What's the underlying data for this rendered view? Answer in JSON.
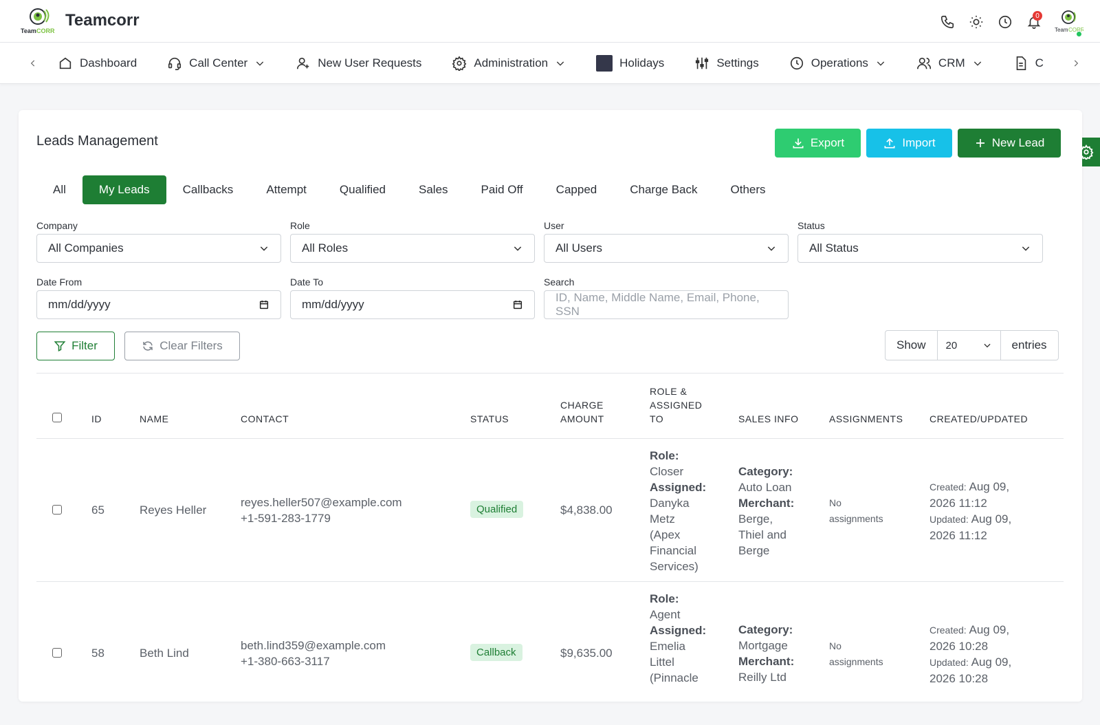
{
  "app": {
    "brand": "Teamcorr",
    "logo_text": "TeamCORR",
    "notifications_count": "0"
  },
  "nav": {
    "items": [
      {
        "label": "Dashboard",
        "icon": "home-icon",
        "dropdown": false
      },
      {
        "label": "Call Center",
        "icon": "headset-icon",
        "dropdown": true
      },
      {
        "label": "New User Requests",
        "icon": "user-plus-icon",
        "dropdown": false
      },
      {
        "label": "Administration",
        "icon": "gear-icon",
        "dropdown": true
      },
      {
        "label": "Holidays",
        "icon": "holiday-square-icon",
        "dropdown": false
      },
      {
        "label": "Settings",
        "icon": "sliders-icon",
        "dropdown": false
      },
      {
        "label": "Operations",
        "icon": "clock-icon",
        "dropdown": true
      },
      {
        "label": "CRM",
        "icon": "users-icon",
        "dropdown": true
      },
      {
        "label": "C",
        "icon": "document-icon",
        "dropdown": false
      }
    ]
  },
  "page": {
    "title": "Leads Management",
    "export_label": "Export",
    "import_label": "Import",
    "new_lead_label": "New Lead"
  },
  "tabs": [
    "All",
    "My Leads",
    "Callbacks",
    "Attempt",
    "Qualified",
    "Sales",
    "Paid Off",
    "Capped",
    "Charge Back",
    "Others"
  ],
  "active_tab": "My Leads",
  "filters": {
    "company": {
      "label": "Company",
      "value": "All Companies"
    },
    "role": {
      "label": "Role",
      "value": "All Roles"
    },
    "user": {
      "label": "User",
      "value": "All Users"
    },
    "status": {
      "label": "Status",
      "value": "All Status"
    },
    "date_from": {
      "label": "Date From",
      "value": "mm/dd/yyyy"
    },
    "date_to": {
      "label": "Date To",
      "value": "mm/dd/yyyy"
    },
    "search": {
      "label": "Search",
      "placeholder": "ID, Name, Middle Name, Email, Phone, SSN"
    },
    "filter_label": "Filter",
    "clear_label": "Clear Filters"
  },
  "entries": {
    "show": "Show",
    "value": "20",
    "suffix": "entries"
  },
  "table": {
    "headers": {
      "id": "ID",
      "name": "NAME",
      "contact": "CONTACT",
      "status": "STATUS",
      "charge_1": "CHARGE",
      "charge_2": "AMOUNT",
      "role_1": "ROLE &",
      "role_2": "ASSIGNED",
      "role_3": "TO",
      "sales": "SALES INFO",
      "assignments": "ASSIGNMENTS",
      "created": "CREATED/UPDATED"
    },
    "labels": {
      "role": "Role:",
      "assigned": "Assigned:",
      "category": "Category:",
      "merchant": "Merchant:",
      "created": "Created:",
      "updated": "Updated:"
    },
    "rows": [
      {
        "id": "65",
        "name": "Reyes Heller",
        "email": "reyes.heller507@example.com",
        "phone": "+1-591-283-1779",
        "status": "Qualified",
        "amount": "$4,838.00",
        "role": "Closer",
        "assigned_1": "Danyka",
        "assigned_2": "Metz",
        "assigned_3": "(Apex",
        "assigned_4": "Financial",
        "assigned_5": "Services)",
        "category": "Auto Loan",
        "merchant_1": "Berge,",
        "merchant_2": "Thiel and",
        "merchant_3": "Berge",
        "assign_1": "No",
        "assign_2": "assignments",
        "created_1": "Aug 09,",
        "created_2": "2026 11:12",
        "updated_1": "Aug 09,",
        "updated_2": "2026 11:12"
      },
      {
        "id": "58",
        "name": "Beth Lind",
        "email": "beth.lind359@example.com",
        "phone": "+1-380-663-3117",
        "status": "Callback",
        "amount": "$9,635.00",
        "role": "Agent",
        "assigned_1": "Emelia",
        "assigned_2": "Littel",
        "assigned_3": "(Pinnacle",
        "category": "Mortgage",
        "merchant_1": "Reilly Ltd",
        "assign_1": "No",
        "assign_2": "assignments",
        "created_1": "Aug 09,",
        "created_2": "2026 10:28",
        "updated_1": "Aug 09,",
        "updated_2": "2026 10:28"
      }
    ]
  }
}
